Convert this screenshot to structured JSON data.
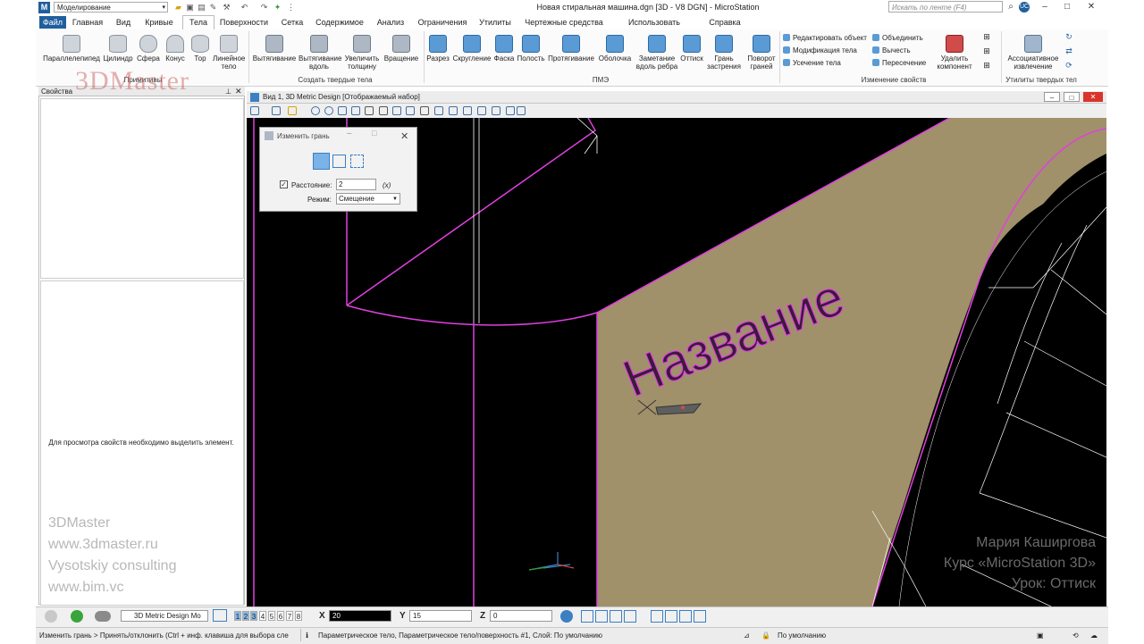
{
  "app": {
    "workflow": "Моделирование",
    "document_title": "Новая стиральная машина.dgn [3D - V8 DGN] - MicroStation",
    "search_placeholder": "Искать по ленте (F4)",
    "user_initials": "UC"
  },
  "tabs": [
    "Файл",
    "Главная",
    "Вид",
    "Кривые",
    "Тела",
    "Поверхности",
    "Сетка",
    "Содержимое",
    "Анализ",
    "Ограничения",
    "Утилиты",
    "Чертежные средства",
    "Использовать совместно",
    "Справка"
  ],
  "active_tab": "Тела",
  "ribbon": {
    "primitives": {
      "group_label": "Примитивы",
      "buttons": [
        "Параллелепипед",
        "Цилиндр",
        "Сфера",
        "Конус",
        "Тор",
        "Линейное тело"
      ]
    },
    "create_solids": {
      "group_label": "Создать твердые тела",
      "buttons": [
        "Вытягивание",
        "Вытягивание вдоль",
        "Увеличить толщину",
        "Вращение"
      ]
    },
    "pme": {
      "group_label": "ПМЭ",
      "buttons": [
        "Разрез",
        "Скругление",
        "Фаска",
        "Полость",
        "Протягивание",
        "Оболочка",
        "Заметание вдоль ребра",
        "Оттиск",
        "Грань застрения",
        "Поворот граней"
      ]
    },
    "modify": {
      "group_label": "Изменение свойств",
      "small_buttons": [
        "Редактировать объект",
        "Модификация тела",
        "Усечение тела",
        "Объединить",
        "Вычесть",
        "Пересечение"
      ],
      "delete_component": "Удалить компонент"
    },
    "utils": {
      "group_label": "Утилиты твердых тел",
      "buttons": [
        "Ассоциативное извлечение"
      ]
    }
  },
  "properties_panel": {
    "title": "Свойства",
    "empty_message": "Для просмотра свойств необходимо выделить элемент."
  },
  "brand_watermark": "3DMaster",
  "left_watermark": [
    "3DMaster",
    "www.3dmaster.ru",
    "Vysotskiy consulting",
    "www.bim.vc"
  ],
  "right_watermark": [
    "Мария Каширгова",
    "Курс «MicroStation 3D»",
    "Урок: Оттиск"
  ],
  "view": {
    "title": "Вид 1, 3D Metric Design [Отображаемый набор]",
    "label_text": "Название"
  },
  "dialog": {
    "title": "Изменить грань",
    "distance_label": "Расстояние:",
    "distance_value": "2",
    "distance_checked": true,
    "fx": "(x)",
    "mode_label": "Режим:",
    "mode_value": "Смещение"
  },
  "controls": {
    "view_select": "3D Metric Design Mo",
    "view_numbers": [
      "1",
      "2",
      "3",
      "4",
      "5",
      "6",
      "7",
      "8"
    ],
    "x_label": "X",
    "x_value": "20",
    "y_label": "Y",
    "y_value": "15",
    "z_label": "Z",
    "z_value": "0"
  },
  "status": {
    "prompt": "Изменить грань > Принять/отклонить (Ctrl + инф. клавиша для выбора сле",
    "message": "Параметрическое тело, Параметрическое тело/поверхность #1, Слой: По умолчанию",
    "level": "По умолчанию"
  },
  "colors": {
    "accent": "#1f5f9d",
    "magenta": "#e040e0",
    "tan_face": "#a0916a",
    "viewport_bg": "#000000"
  }
}
